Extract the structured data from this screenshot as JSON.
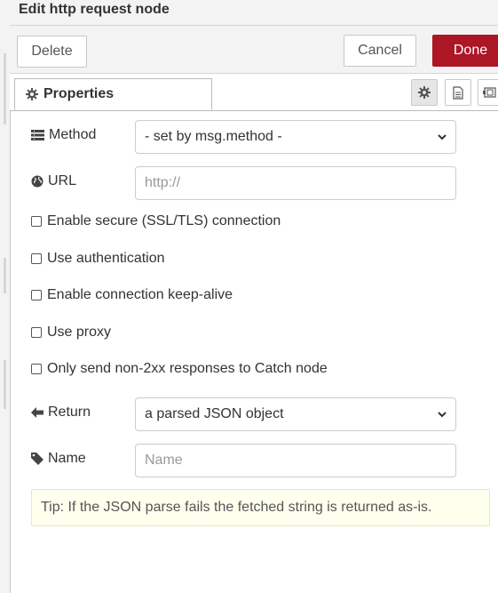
{
  "window": {
    "title": "Edit http request node"
  },
  "toolbar": {
    "delete_label": "Delete",
    "cancel_label": "Cancel",
    "done_label": "Done",
    "done_color": "#ad1625"
  },
  "tabs": {
    "properties_label": "Properties",
    "icons": [
      "gear-icon",
      "description-icon",
      "appearance-icon"
    ]
  },
  "form": {
    "method": {
      "label": "Method",
      "value": "- set by msg.method -",
      "icon": "list-icon"
    },
    "url": {
      "label": "URL",
      "placeholder": "http://",
      "icon": "globe-icon"
    },
    "checkboxes": [
      {
        "label": "Enable secure (SSL/TLS) connection",
        "checked": false
      },
      {
        "label": "Use authentication",
        "checked": false
      },
      {
        "label": "Enable connection keep-alive",
        "checked": false
      },
      {
        "label": "Use proxy",
        "checked": false
      },
      {
        "label": "Only send non-2xx responses to Catch node",
        "checked": false
      }
    ],
    "ret": {
      "label": "Return",
      "value": "a parsed JSON object",
      "icon": "arrow-left-icon"
    },
    "name": {
      "label": "Name",
      "placeholder": "Name",
      "icon": "tag-icon"
    }
  },
  "tip": {
    "text": "Tip: If the JSON parse fails the fetched string is returned as-is."
  }
}
